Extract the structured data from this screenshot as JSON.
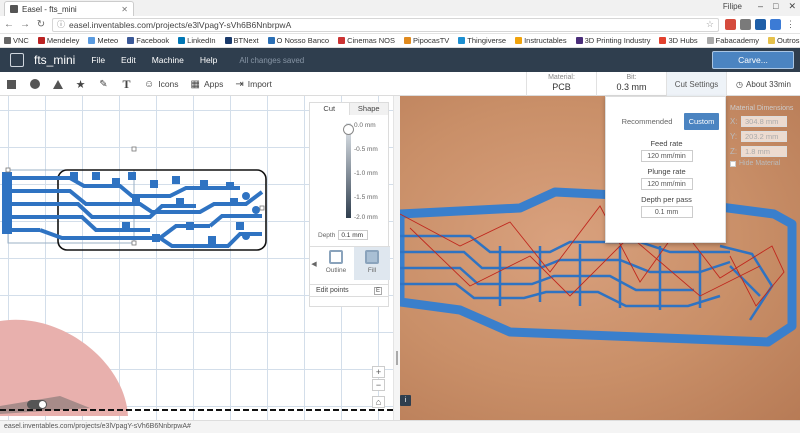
{
  "browser": {
    "tab_title": "Easel - fts_mini",
    "user": "Filipe",
    "url": "easel.inventables.com/projects/e3lVpagY-sVh6B6NnbrpwA",
    "bookmarks": [
      "VNC",
      "Mendeley",
      "Meteo",
      "Facebook",
      "LinkedIn",
      "BTNext",
      "O Nosso Banco",
      "Cinemas NOS",
      "PipocasTV",
      "Thingiverse",
      "Instructables",
      "3D Printing Industry",
      "3D Hubs",
      "Fabacademy"
    ],
    "other_bookmarks": "Outros marcadores",
    "status_url": "easel.inventables.com/projects/e3lVpagY-sVh6B6NnbrpwA#"
  },
  "app": {
    "project_name": "fts_mini",
    "menu": [
      "File",
      "Edit",
      "Machine",
      "Help"
    ],
    "save_status": "All changes saved",
    "carve_label": "Carve...",
    "tools": {
      "icons_label": "Icons",
      "apps_label": "Apps",
      "import_label": "Import",
      "text_glyph": "T"
    }
  },
  "material_bar": {
    "material_key": "Material:",
    "material_value": "PCB",
    "bit_key": "Bit:",
    "bit_value": "0.3 mm",
    "cut_settings_label": "Cut Settings",
    "time_label": "About 33min"
  },
  "shape_panel": {
    "tabs": [
      "Cut",
      "Shape"
    ],
    "depth_ticks": [
      "0.0 mm",
      "-0.5 mm",
      "-1.0 mm",
      "-1.5 mm",
      "-2.0 mm"
    ],
    "depth_label": "Depth",
    "depth_value": "0.1 mm",
    "outline_label": "Outline",
    "fill_label": "Fill",
    "edit_points_label": "Edit points"
  },
  "cut_settings": {
    "recommended_label": "Recommended",
    "custom_label": "Custom",
    "feed_rate_label": "Feed rate",
    "feed_rate_value": "120 mm/min",
    "plunge_rate_label": "Plunge rate",
    "plunge_rate_value": "120 mm/min",
    "depth_per_pass_label": "Depth per pass",
    "depth_per_pass_value": "0.1 mm"
  },
  "material_dims": {
    "header": "Material Dimensions",
    "x_label": "X:",
    "x_value": "304.8 mm",
    "y_label": "Y:",
    "y_value": "203.2 mm",
    "z_label": "Z:",
    "z_value": "1.8 mm",
    "hide_label": "Hide Material"
  },
  "colors": {
    "header_bg": "#2f3e4e",
    "accent_blue": "#4b84c1",
    "trace_blue": "#2f73c2",
    "wood": "#c98f68"
  }
}
